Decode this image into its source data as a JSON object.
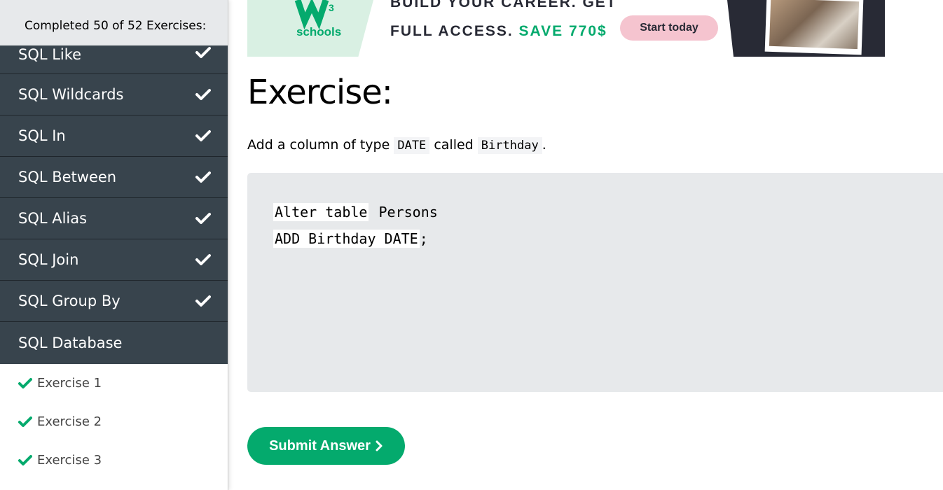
{
  "sidebar": {
    "progress_text": "Completed 50 of 52 Exercises:",
    "topics": [
      {
        "label": "SQL Like",
        "completed": true
      },
      {
        "label": "SQL Wildcards",
        "completed": true
      },
      {
        "label": "SQL In",
        "completed": true
      },
      {
        "label": "SQL Between",
        "completed": true
      },
      {
        "label": "SQL Alias",
        "completed": true
      },
      {
        "label": "SQL Join",
        "completed": true
      },
      {
        "label": "SQL Group By",
        "completed": true
      },
      {
        "label": "SQL Database",
        "completed": false
      }
    ],
    "exercises": [
      {
        "label": "Exercise 1",
        "completed": true
      },
      {
        "label": "Exercise 2",
        "completed": true
      },
      {
        "label": "Exercise 3",
        "completed": true
      }
    ]
  },
  "banner": {
    "logo_text": "schools",
    "line1": "BUILD YOUR CAREER. GET",
    "line2_prefix": "FULL ACCESS.",
    "line2_highlight": "SAVE 770$",
    "cta_label": "Start today"
  },
  "main": {
    "heading": "Exercise:",
    "instruction": {
      "part1": "Add a column of type",
      "code1": "DATE",
      "part2": "called",
      "code2": "Birthday",
      "part3": "."
    },
    "code": {
      "line1_part1": "Alter table",
      "line1_part2": "Persons",
      "line2_part1": "ADD Birthday DATE",
      "line2_part2": ";"
    },
    "submit_label": "Submit Answer"
  },
  "colors": {
    "accent_green": "#04aa6d",
    "sidebar_dark": "#38444d",
    "code_background": "#e7e9eb"
  }
}
